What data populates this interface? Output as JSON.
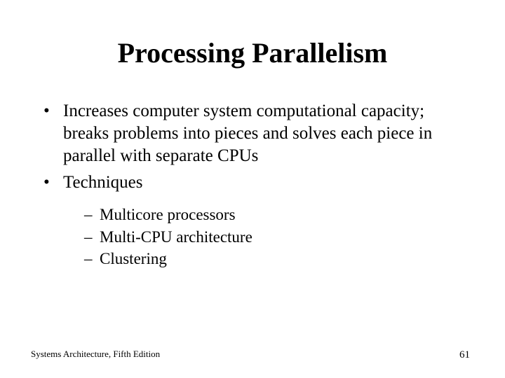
{
  "title": "Processing Parallelism",
  "bullets": {
    "b1": "Increases computer system computational capacity; breaks problems into pieces and solves each piece in parallel with separate CPUs",
    "b2": "Techniques",
    "sub1": "Multicore processors",
    "sub2": "Multi-CPU architecture",
    "sub3": "Clustering"
  },
  "footer": {
    "source": "Systems Architecture, Fifth Edition",
    "page": "61"
  }
}
